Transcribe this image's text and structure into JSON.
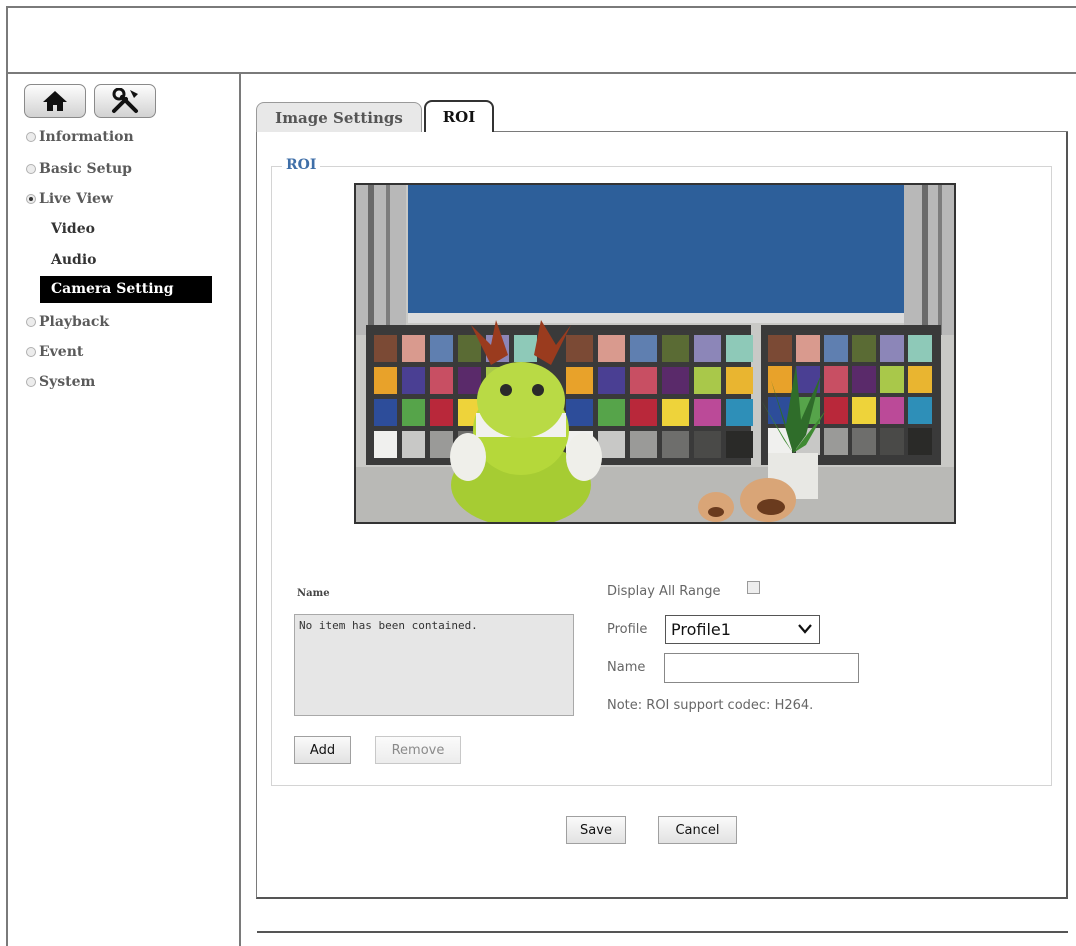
{
  "sidebar": {
    "items": [
      {
        "label": "Information",
        "selected": false
      },
      {
        "label": "Basic Setup",
        "selected": false
      },
      {
        "label": "Live View",
        "selected": true
      },
      {
        "label": "Playback",
        "selected": false
      },
      {
        "label": "Event",
        "selected": false
      },
      {
        "label": "System",
        "selected": false
      }
    ],
    "subitems": [
      {
        "label": "Video"
      },
      {
        "label": "Audio"
      },
      {
        "label": "Camera Setting"
      }
    ]
  },
  "tabs": [
    {
      "label": "Image Settings"
    },
    {
      "label": "ROI"
    }
  ],
  "roi": {
    "legend": "ROI",
    "list_header": "Name",
    "list_empty": "No item has been contained.",
    "add_label": "Add",
    "remove_label": "Remove",
    "display_all_range_label": "Display All Range",
    "display_all_range_checked": false,
    "profile_label": "Profile",
    "profile_value": "Profile1",
    "name_label": "Name",
    "name_value": "",
    "note": "Note: ROI support codec: H264."
  },
  "actions": {
    "save_label": "Save",
    "cancel_label": "Cancel"
  },
  "colors": {
    "legend": "#3f6fa8",
    "active_menu_bg": "#000000"
  },
  "icons": {
    "home": "home-icon",
    "tools": "tools-icon",
    "dropdown": "chevron-down-icon"
  }
}
